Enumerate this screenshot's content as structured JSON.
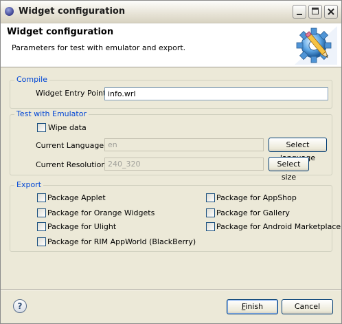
{
  "window": {
    "title": "Widget configuration"
  },
  "banner": {
    "title": "Widget configuration",
    "subtitle": "Parameters for test with emulator and export.",
    "icon": "gear-pencil-icon"
  },
  "compile": {
    "group_label": "Compile",
    "entry_point_label": "Widget Entry Point:",
    "entry_point_value": "info.wrl"
  },
  "test": {
    "group_label": "Test with Emulator",
    "wipe_data_label": "Wipe data",
    "wipe_data_checked": false,
    "language_label": "Current Language:",
    "language_value": "en",
    "select_language_label": "Select language",
    "resolution_label": "Current Resolution:",
    "resolution_value": "240_320",
    "select_size_label": "Select size"
  },
  "export": {
    "group_label": "Export",
    "options": [
      {
        "label": "Package Applet",
        "checked": false
      },
      {
        "label": "Package for Orange Widgets",
        "checked": false
      },
      {
        "label": "Package for Ulight",
        "checked": false
      },
      {
        "label": "Package for RIM AppWorld (BlackBerry)",
        "checked": false
      },
      {
        "label": "Package for AppShop",
        "checked": false
      },
      {
        "label": "Package for Gallery",
        "checked": false
      },
      {
        "label": "Package for Android Marketplace",
        "checked": false
      }
    ]
  },
  "footer": {
    "help_symbol": "?",
    "finish_mnemonic": "F",
    "finish_rest": "inish",
    "cancel_label": "Cancel"
  }
}
